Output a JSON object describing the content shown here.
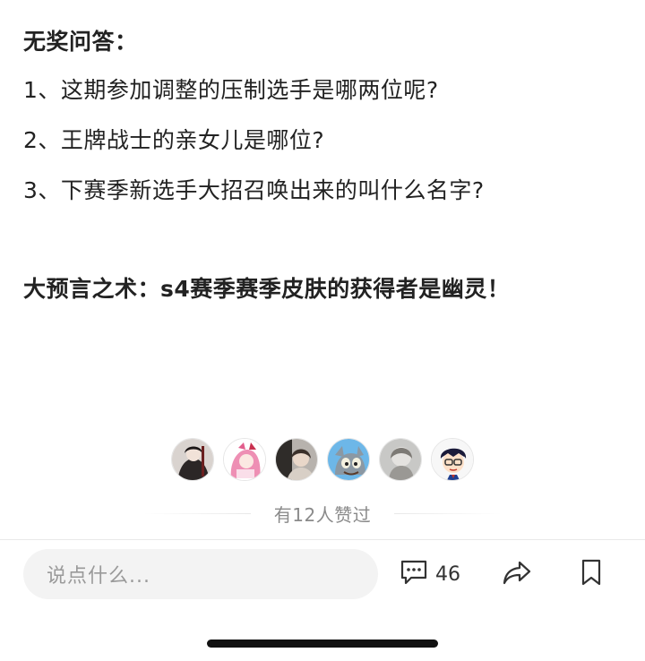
{
  "article": {
    "quiz_title": "无奖问答：",
    "questions": [
      "1、这期参加调整的压制选手是哪两位呢?",
      "2、王牌战士的亲女儿是哪位?",
      "3、下赛季新选手大招召唤出来的叫什么名字?"
    ],
    "prediction": "大预言之术：s4赛季赛季皮肤的获得者是幽灵！"
  },
  "likes": {
    "text": "有12人赞过",
    "avatars": [
      "avatar-1",
      "avatar-2",
      "avatar-3",
      "avatar-4",
      "avatar-5",
      "avatar-6"
    ]
  },
  "bottom_bar": {
    "comment_placeholder": "说点什么...",
    "comment_count": "46",
    "icons": [
      "comment-icon",
      "share-icon",
      "bookmark-icon"
    ]
  },
  "colors": {
    "text": "#222222",
    "muted": "#8a8a8a",
    "input_bg": "#f3f3f3"
  }
}
